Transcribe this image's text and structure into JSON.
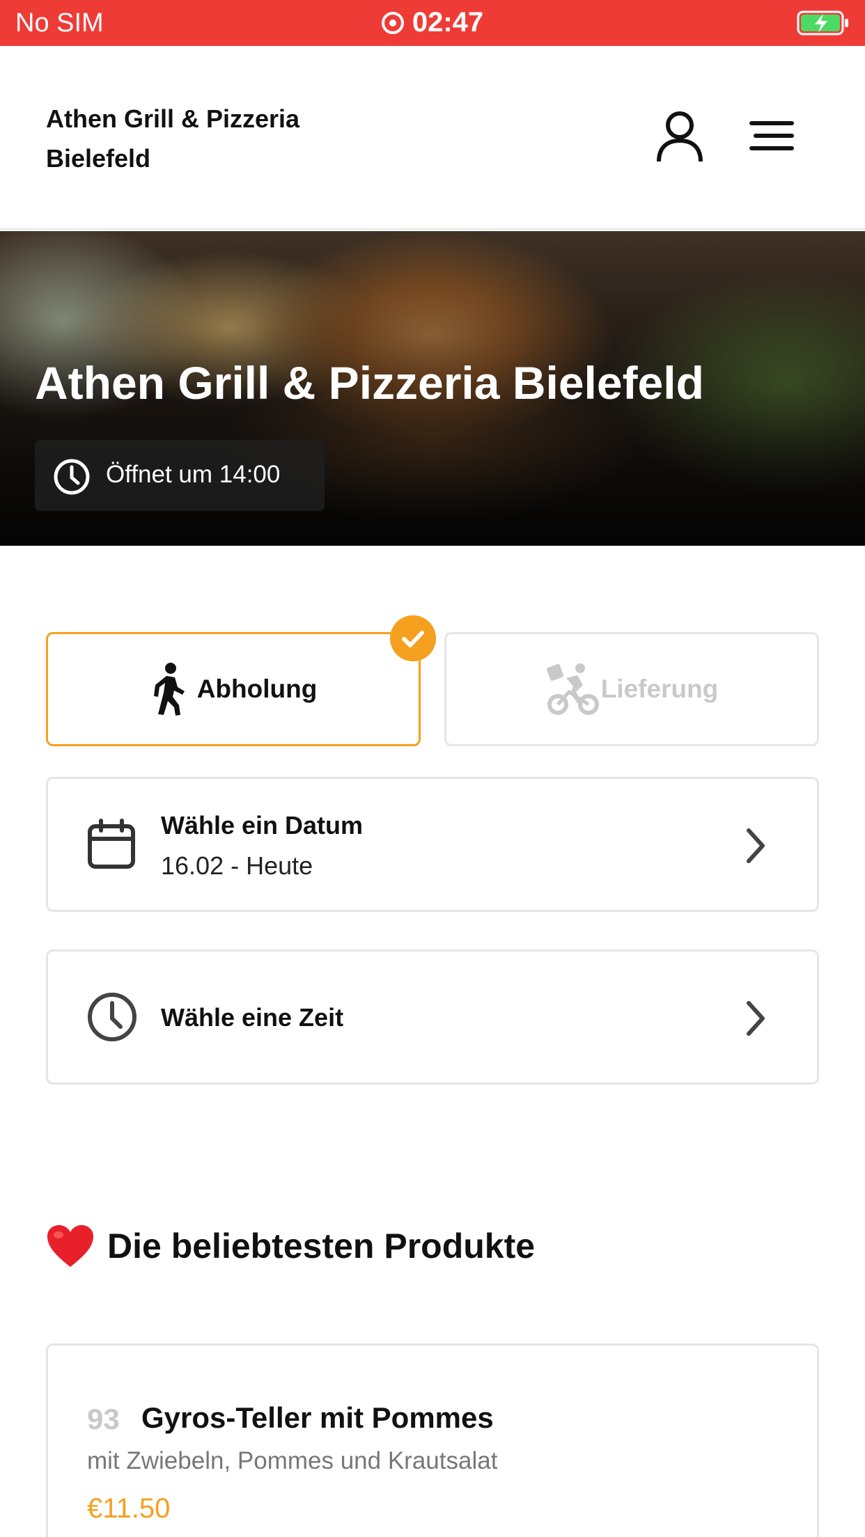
{
  "status_bar": {
    "carrier": "No SIM",
    "time": "02:47",
    "icons": [
      "screen-record-icon",
      "battery-charging-icon"
    ]
  },
  "header": {
    "brand": "Athen Grill & Pizzeria Bielefeld",
    "icons": [
      "user-icon",
      "menu-icon"
    ]
  },
  "hero": {
    "title": "Athen Grill & Pizzeria Bielefeld",
    "badge_text": "Öffnet um 14:00",
    "badge_icon": "clock-icon"
  },
  "order_mode": {
    "selected": "pickup",
    "pickup_label": "Abholung",
    "delivery_label": "Lieferung",
    "accent_color": "#f5a01f",
    "disabled_color": "#c9c9c9"
  },
  "date_selector": {
    "title": "Wähle ein Datum",
    "value": "16.02 - Heute"
  },
  "time_selector": {
    "title": "Wähle eine Zeit"
  },
  "popular": {
    "title": "Die beliebtesten Produkte",
    "products": [
      {
        "number": "93",
        "name": "Gyros-Teller mit Pommes",
        "description": "mit Zwiebeln, Pommes und Krautsalat",
        "price": "€11.50"
      }
    ]
  },
  "colors": {
    "status_bar": "#ef3b36",
    "accent": "#f5a01f"
  }
}
